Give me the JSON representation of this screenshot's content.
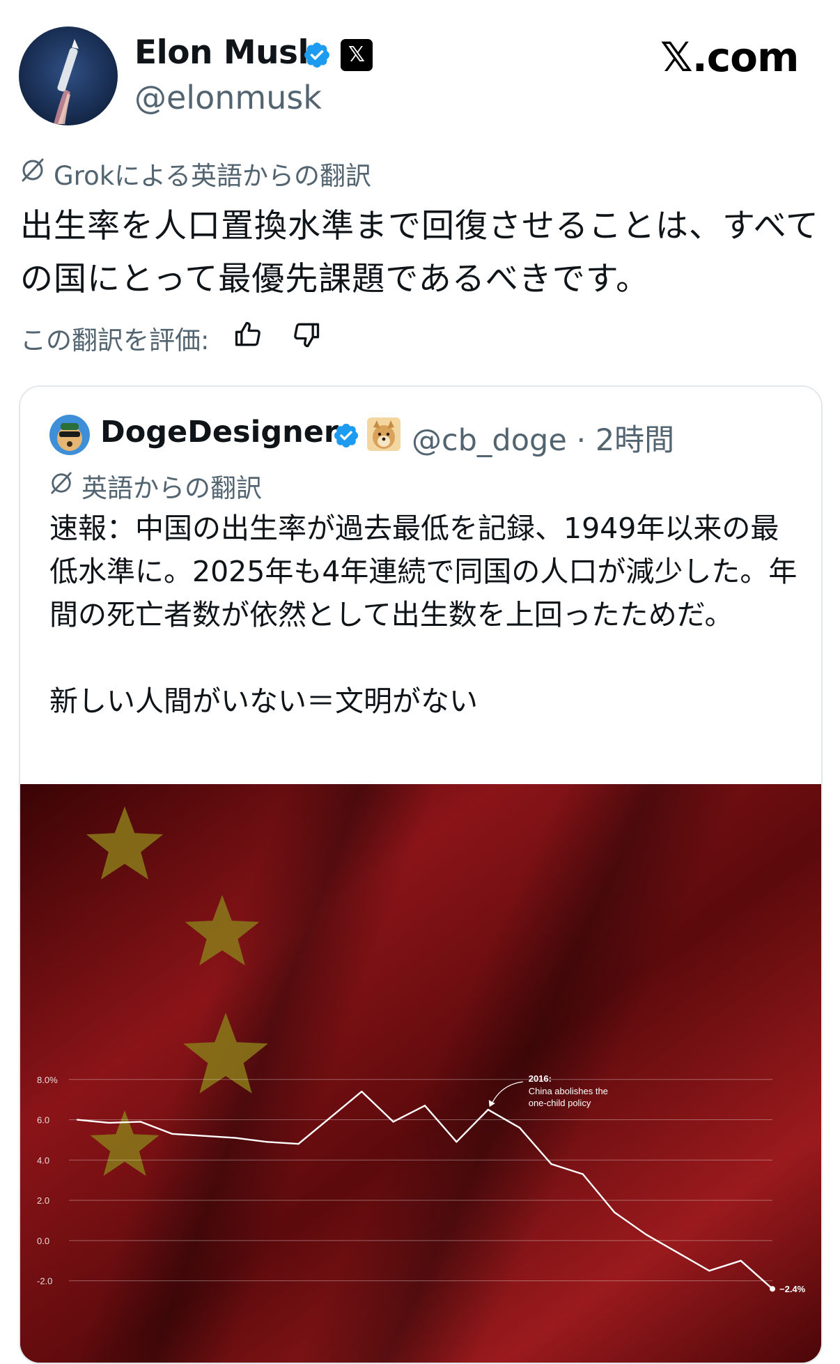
{
  "author": {
    "display_name": "Elon Musk",
    "handle": "@elonmusk",
    "affiliate_badge": "𝕏",
    "avatar_icon": "rocket-avatar-icon"
  },
  "brand": "𝕏.com",
  "translation": {
    "label": "Grokによる英語からの翻訳",
    "icon": "translate-icon"
  },
  "post": {
    "text": "出生率を人口置換水準まで回復させることは、すべての国にとって最優先課題であるべきです。"
  },
  "rating": {
    "label": "この翻訳を評価:",
    "up_icon": "thumbs-up-icon",
    "down_icon": "thumbs-down-icon"
  },
  "quote": {
    "display_name": "DogeDesigner",
    "handle": "@cb_doge",
    "time": "2時間",
    "translation_label": "英語からの翻訳",
    "text": "速報：中国の出生率が過去最低を記録、1949年以来の最低水準に。2025年も4年連続で同国の人口が減少した。年間の死亡者数が依然として出生数を上回ったためだ。\n\n新しい人間がいない＝文明がない",
    "colors": {
      "verified": "#1d9bf0",
      "muted": "#536471"
    }
  },
  "chart_data": {
    "type": "line",
    "title": "",
    "xlabel": "",
    "ylabel": "",
    "y_ticks": [
      "8.0%",
      "6.0",
      "4.0",
      "2.0",
      "0.0",
      "-2.0"
    ],
    "ylim": [
      -2.6,
      8.2
    ],
    "grid": true,
    "series": [
      {
        "values": [
          6.0,
          5.85,
          5.9,
          5.3,
          5.2,
          5.1,
          4.9,
          4.8,
          6.1,
          7.4,
          5.9,
          6.7,
          4.9,
          6.5,
          5.6,
          3.8,
          3.3,
          1.4,
          0.3,
          -0.6,
          -1.5,
          -1.0,
          -2.4
        ]
      }
    ],
    "annotations": [
      {
        "text_year": "2016:",
        "text_body": "China abolishes the one-child policy"
      },
      {
        "text": "−2.4%"
      }
    ],
    "colors": {
      "line": "#ffffff",
      "background": "#6b0d10",
      "star": "#8a7a1a"
    }
  }
}
